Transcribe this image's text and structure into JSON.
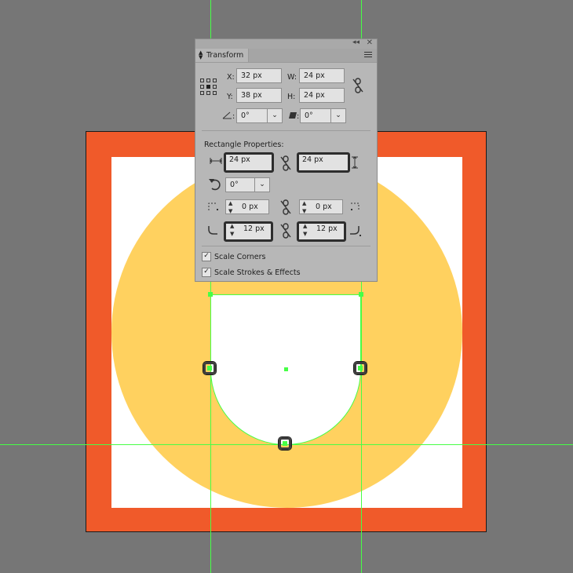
{
  "colors": {
    "canvas_bg": "#767676",
    "artboard_frame": "#F05A2A",
    "artboard_fill": "#FFFFFF",
    "circle_fill": "#FFD15F",
    "selection": "#46FF46",
    "shape_fill": "#FFFFFF"
  },
  "panel": {
    "title": "Transform",
    "collapse_icon": "double-chevron-left",
    "close_icon": "close",
    "x_label": "X:",
    "x_value": "32 px",
    "y_label": "Y:",
    "y_value": "38 px",
    "w_label": "W:",
    "w_value": "24 px",
    "h_label": "H:",
    "h_value": "24 px",
    "angle_value": "0°",
    "shear_value": "0°",
    "rect_props_label": "Rectangle Properties:",
    "rect_width": "24 px",
    "rect_height": "24 px",
    "rotation_value": "0°",
    "corner_top_left": "0 px",
    "corner_top_right": "0 px",
    "corner_bottom_left": "12 px",
    "corner_bottom_right": "12 px",
    "scale_corners_label": "Scale Corners",
    "scale_corners_checked": true,
    "scale_strokes_label": "Scale Strokes & Effects",
    "scale_strokes_checked": true,
    "checkmark": "✓"
  }
}
